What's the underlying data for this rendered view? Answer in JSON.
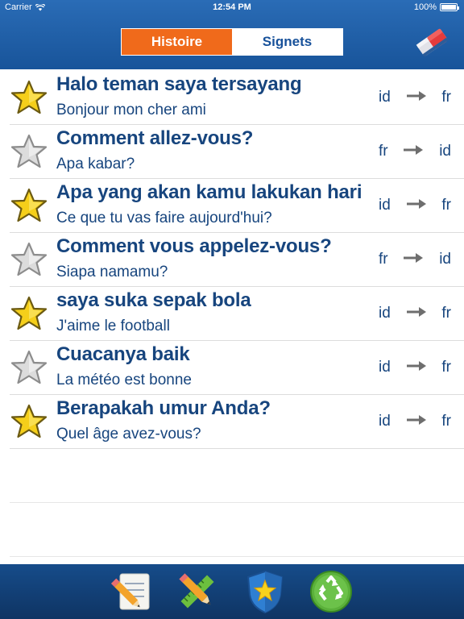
{
  "status": {
    "carrier": "Carrier",
    "time": "12:54 PM",
    "battery": "100%"
  },
  "tabs": [
    {
      "label": "Histoire",
      "active": true
    },
    {
      "label": "Signets",
      "active": false
    }
  ],
  "colors": {
    "accent": "#f06a1b",
    "header": "#1f5fa8",
    "text": "#17457e",
    "star_on": "#f5cf1a",
    "star_off": "#d8d8d8"
  },
  "rows": [
    {
      "source": "Halo teman saya tersayang",
      "translation": "Bonjour mon cher ami",
      "from": "id",
      "to": "fr",
      "starred": true
    },
    {
      "source": "Comment allez-vous?",
      "translation": "Apa kabar?",
      "from": "fr",
      "to": "id",
      "starred": false
    },
    {
      "source": "Apa yang akan kamu lakukan hari",
      "translation": "Ce que tu vas faire aujourd'hui?",
      "from": "id",
      "to": "fr",
      "starred": true
    },
    {
      "source": "Comment vous appelez-vous?",
      "translation": "Siapa namamu?",
      "from": "fr",
      "to": "id",
      "starred": false
    },
    {
      "source": "saya suka sepak bola",
      "translation": "J'aime le football",
      "from": "id",
      "to": "fr",
      "starred": true
    },
    {
      "source": "Cuacanya baik",
      "translation": "La météo est bonne",
      "from": "id",
      "to": "fr",
      "starred": false
    },
    {
      "source": "Berapakah umur Anda?",
      "translation": "Quel âge avez-vous?",
      "from": "id",
      "to": "fr",
      "starred": true
    }
  ],
  "icons": {
    "clear": "eraser-icon",
    "toolbar": [
      "notepad-pencil-icon",
      "pencil-ruler-icon",
      "star-shield-icon",
      "recycle-icon"
    ]
  }
}
